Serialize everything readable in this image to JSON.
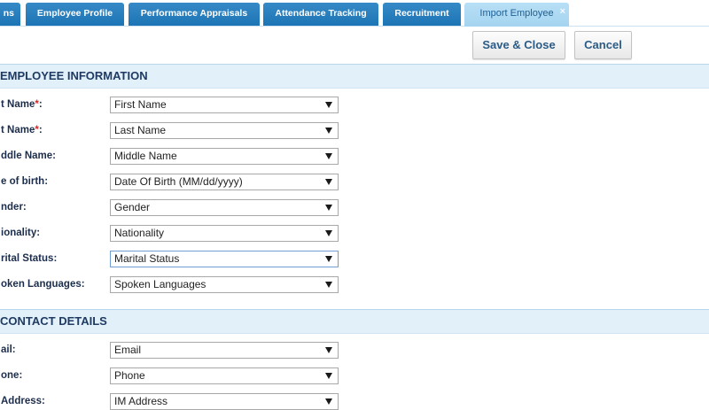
{
  "tabs": [
    {
      "label": "ns",
      "active": false
    },
    {
      "label": "Employee Profile",
      "active": false
    },
    {
      "label": "Performance Appraisals",
      "active": false
    },
    {
      "label": "Attendance Tracking",
      "active": false
    },
    {
      "label": "Recruitment",
      "active": false
    },
    {
      "label": "Import Employee",
      "active": true,
      "close_glyph": "×"
    }
  ],
  "toolbar": {
    "save_close_label": "Save & Close",
    "cancel_label": "Cancel"
  },
  "form": {
    "required_mark": "*",
    "label_suffix": ":"
  },
  "sections": [
    {
      "title": "EMPLOYEE INFORMATION",
      "fields": [
        {
          "label": "t Name",
          "required": true,
          "value": "First Name"
        },
        {
          "label": "t Name",
          "required": true,
          "value": "Last Name"
        },
        {
          "label": "ddle Name",
          "required": false,
          "value": "Middle Name"
        },
        {
          "label": "e of birth",
          "required": false,
          "value": "Date Of Birth (MM/dd/yyyy)"
        },
        {
          "label": "nder",
          "required": false,
          "value": "Gender"
        },
        {
          "label": "ionality",
          "required": false,
          "value": "Nationality"
        },
        {
          "label": "rital Status",
          "required": false,
          "value": "Marital Status",
          "focused": true
        },
        {
          "label": "oken Languages",
          "required": false,
          "value": "Spoken Languages"
        }
      ]
    },
    {
      "title": "CONTACT DETAILS",
      "fields": [
        {
          "label": "ail",
          "required": false,
          "value": "Email"
        },
        {
          "label": "one",
          "required": false,
          "value": "Phone"
        },
        {
          "label": "Address",
          "required": false,
          "value": "IM Address"
        }
      ]
    }
  ],
  "icons": {
    "dropdown": "caret-down-icon",
    "tab_close": "close-icon"
  },
  "colors": {
    "tab": "#1f7cc0",
    "tab_active": "#a8d8f4",
    "tab_active_text": "#1d5f95",
    "button_text": "#2b5b86",
    "section_header_bg": "#e2f0fa",
    "section_header_text": "#1f3b63",
    "label_text": "#1c2d4c",
    "required": "#d42a2a",
    "focus_border": "#6f9fd6"
  }
}
